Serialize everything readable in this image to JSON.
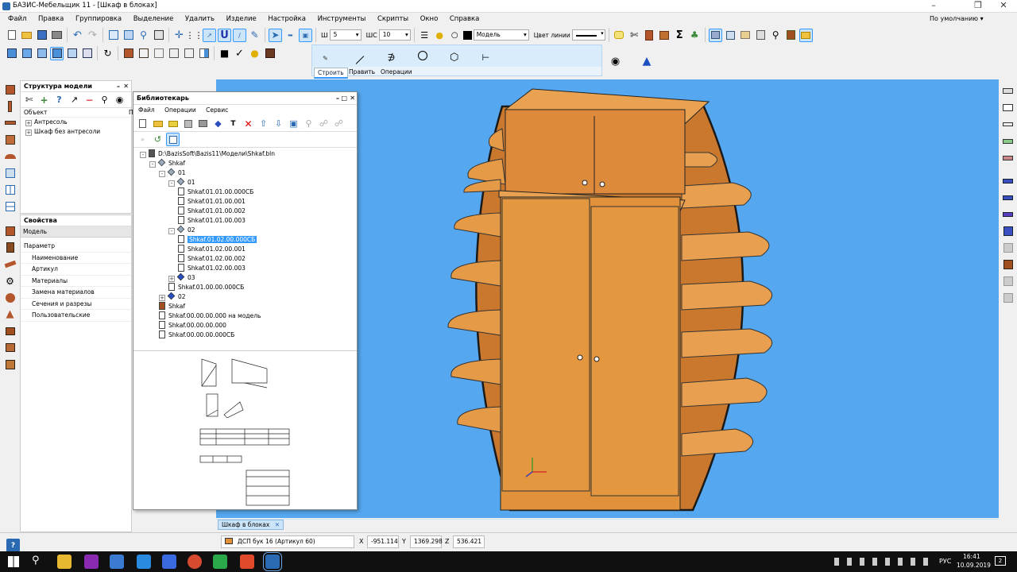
{
  "window": {
    "title": "БАЗИС-Мебельщик 11 - [Шкаф в блоках]"
  },
  "menu": [
    "Файл",
    "Правка",
    "Группировка",
    "Выделение",
    "Удалить",
    "Изделие",
    "Настройка",
    "Инструменты",
    "Скрипты",
    "Окно",
    "Справка"
  ],
  "menu_right": "По умолчанию",
  "toolbar": {
    "w_label": "Ш",
    "w_value": "5",
    "ws_label": "ШС",
    "ws_value": "10",
    "layer_value": "Модель",
    "line_color_label": "Цвет линии"
  },
  "ribbon": {
    "tabs": [
      "Строить",
      "Править",
      "Операции"
    ]
  },
  "model_structure": {
    "title": "Структура модели",
    "column_object": "Объект",
    "column_p": "П",
    "items": [
      "Антресоль",
      "Шкаф без антресоли"
    ]
  },
  "properties": {
    "title": "Свойства",
    "tab": "Модель",
    "header": "Параметр",
    "rows": [
      "Наименование",
      "Артикул",
      "Материалы",
      "Замена материалов",
      "Сечения и разрезы",
      "Пользовательские"
    ]
  },
  "librarian": {
    "title": "Библиотекарь",
    "menu": [
      "Файл",
      "Операции",
      "Сервис"
    ],
    "tree": [
      {
        "level": 0,
        "icon": "folder",
        "text": "D:\\BazisSoft\\Bazis11\\Модели\\Shkaf.bln"
      },
      {
        "level": 1,
        "icon": "asm",
        "text": "Shkaf"
      },
      {
        "level": 2,
        "icon": "asm",
        "text": "01"
      },
      {
        "level": 3,
        "icon": "asm",
        "text": "01"
      },
      {
        "level": 4,
        "icon": "doc",
        "text": "Shkaf.01.01.00.000СБ"
      },
      {
        "level": 4,
        "icon": "doc",
        "text": "Shkaf.01.01.00.001"
      },
      {
        "level": 4,
        "icon": "doc",
        "text": "Shkaf.01.01.00.002"
      },
      {
        "level": 4,
        "icon": "doc",
        "text": "Shkaf.01.01.00.003"
      },
      {
        "level": 3,
        "icon": "asm",
        "text": "02"
      },
      {
        "level": 4,
        "icon": "doc",
        "text": "Shkaf.01.02.00.000СБ",
        "selected": true
      },
      {
        "level": 4,
        "icon": "doc",
        "text": "Shkaf.01.02.00.001"
      },
      {
        "level": 4,
        "icon": "doc",
        "text": "Shkaf.01.02.00.002"
      },
      {
        "level": 4,
        "icon": "doc",
        "text": "Shkaf.01.02.00.003"
      },
      {
        "level": 3,
        "icon": "asm2",
        "text": "03"
      },
      {
        "level": 3,
        "icon": "doc",
        "text": "Shkaf.01.00.00.000СБ"
      },
      {
        "level": 2,
        "icon": "asm2",
        "text": "02"
      },
      {
        "level": 2,
        "icon": "model",
        "text": "Shkaf"
      },
      {
        "level": 2,
        "icon": "doc",
        "text": "Shkaf.00.00.00.000 на модель"
      },
      {
        "level": 2,
        "icon": "doc",
        "text": "Shkaf.00.00.00.000"
      },
      {
        "level": 2,
        "icon": "doc",
        "text": "Shkaf.00.00.00.000СБ"
      }
    ]
  },
  "document_tab": "Шкаф в блоках",
  "status": {
    "material": "ДСП бук 16 (Артикул 60)",
    "x_label": "X",
    "x": "-951.114",
    "y_label": "Y",
    "y": "1369.298",
    "z_label": "Z",
    "z": "536.421"
  },
  "taskbar": {
    "lang": "РУС",
    "time": "16:41",
    "date": "10.09.2019",
    "notif": "2"
  },
  "colors": {
    "viewport_bg": "#55a7ef",
    "wood": "#e0913a",
    "accent": "#3399ff"
  }
}
